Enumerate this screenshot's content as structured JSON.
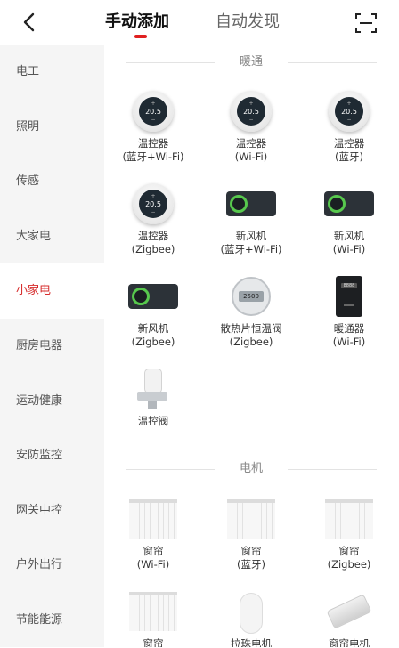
{
  "header": {
    "tab_manual": "手动添加",
    "tab_auto": "自动发现",
    "back_icon": "chevron-left-icon",
    "scan_icon": "scan-icon"
  },
  "sidebar": {
    "items": [
      {
        "label": "电工"
      },
      {
        "label": "照明"
      },
      {
        "label": "传感"
      },
      {
        "label": "大家电"
      },
      {
        "label": "小家电",
        "active": true
      },
      {
        "label": "厨房电器"
      },
      {
        "label": "运动健康"
      },
      {
        "label": "安防监控"
      },
      {
        "label": "网关中控"
      },
      {
        "label": "户外出行"
      },
      {
        "label": "节能能源"
      }
    ]
  },
  "colors": {
    "accent": "#d62c2c",
    "sidebar_bg": "#f5f5f5"
  },
  "sections": [
    {
      "title": "暖通",
      "devices": [
        {
          "name": "温控器",
          "sub": "(蓝牙+Wi-Fi)",
          "icon": "thermostat-icon",
          "display": "20.5"
        },
        {
          "name": "温控器",
          "sub": "(Wi-Fi)",
          "icon": "thermostat-icon",
          "display": "20.5"
        },
        {
          "name": "温控器",
          "sub": "(蓝牙)",
          "icon": "thermostat-icon",
          "display": "20.5"
        },
        {
          "name": "温控器",
          "sub": "(Zigbee)",
          "icon": "thermostat-icon",
          "display": "20.5"
        },
        {
          "name": "新风机",
          "sub": "(蓝牙+Wi-Fi)",
          "icon": "fresh-air-panel-icon"
        },
        {
          "name": "新风机",
          "sub": "(Wi-Fi)",
          "icon": "fresh-air-panel-icon"
        },
        {
          "name": "新风机",
          "sub": "(Zigbee)",
          "icon": "fresh-air-panel-icon"
        },
        {
          "name": "散热片恒温阀",
          "sub": "(Zigbee)",
          "icon": "radiator-valve-icon",
          "display": "2500"
        },
        {
          "name": "暖通器",
          "sub": "(Wi-Fi)",
          "icon": "hvac-controller-icon",
          "display": "8888"
        },
        {
          "name": "温控阀",
          "sub": "",
          "icon": "thermostatic-valve-icon"
        }
      ]
    },
    {
      "title": "电机",
      "devices": [
        {
          "name": "窗帘",
          "sub": "(Wi-Fi)",
          "icon": "curtain-icon"
        },
        {
          "name": "窗帘",
          "sub": "(蓝牙)",
          "icon": "curtain-icon"
        },
        {
          "name": "窗帘",
          "sub": "(Zigbee)",
          "icon": "curtain-icon"
        },
        {
          "name": "窗帘",
          "sub": "",
          "icon": "curtain-icon"
        },
        {
          "name": "拉珠电机",
          "sub": "",
          "icon": "bead-chain-motor-icon"
        },
        {
          "name": "窗帘电机",
          "sub": "",
          "icon": "curtain-motor-icon"
        }
      ]
    }
  ]
}
